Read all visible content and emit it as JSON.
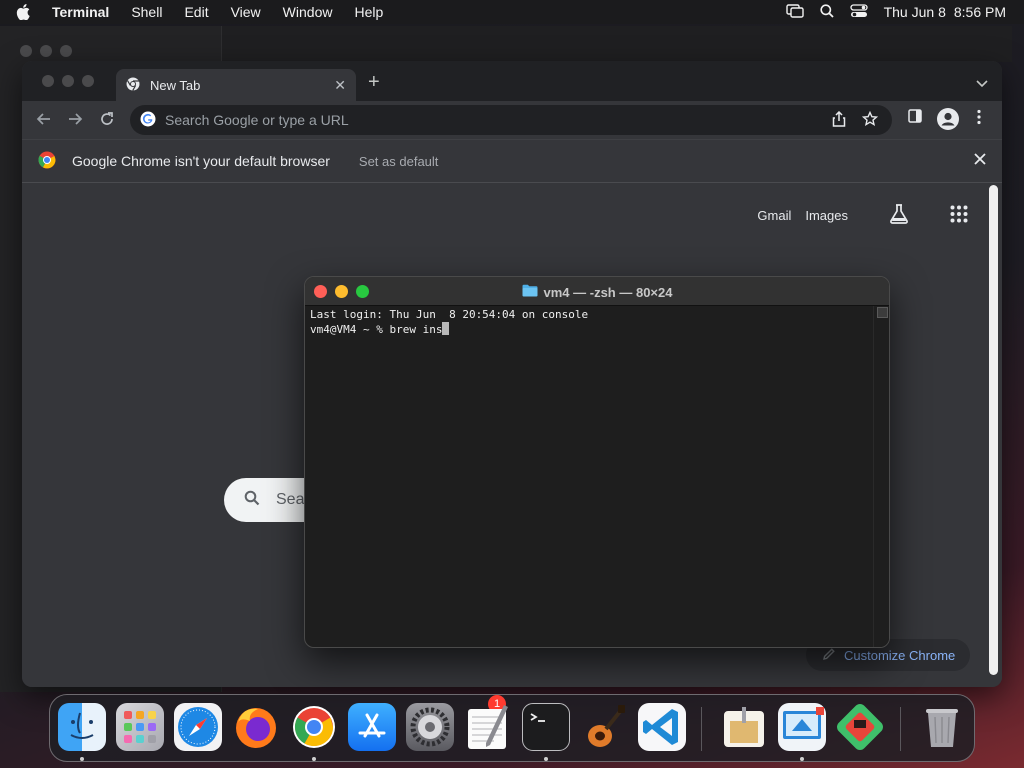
{
  "menubar": {
    "app_name": "Terminal",
    "items": [
      "Shell",
      "Edit",
      "View",
      "Window",
      "Help"
    ],
    "date": "Thu Jun 8",
    "time": "8:56 PM"
  },
  "chrome": {
    "tab_title": "New Tab",
    "omnibox_placeholder": "Search Google or type a URL",
    "infobar_message": "Google Chrome isn't your default browser",
    "infobar_action": "Set as default",
    "ntp_links": [
      "Gmail",
      "Images"
    ],
    "search_hint": "Sea",
    "customize_label": "Customize Chrome"
  },
  "terminal": {
    "title": "vm4 — -zsh — 80×24",
    "line1": "Last login: Thu Jun  8 20:54:04 on console",
    "line2": "vm4@VM4 ~ % brew ins"
  },
  "dock": {
    "apps": [
      "finder",
      "launchpad",
      "safari",
      "firefox",
      "chrome",
      "app-store",
      "system-settings",
      "textedit",
      "terminal",
      "garageband",
      "vscode",
      "archive-utility",
      "remote-desktop",
      "gameboy-emulator",
      "trash"
    ],
    "settings_badge": "1"
  },
  "colors": {
    "traffic_red": "#ff5f57",
    "traffic_yellow": "#febc2e",
    "traffic_green": "#28c840",
    "link_blue": "#8ab4f8"
  }
}
